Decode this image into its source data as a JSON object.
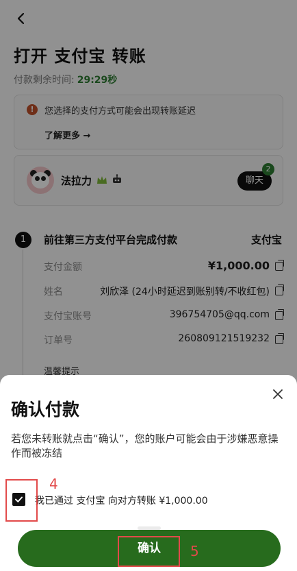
{
  "page": {
    "title": "打开 支付宝 转账",
    "timer_label": "付款剩余时间:",
    "timer_value": "29:29秒",
    "warning_text": "您选择的支付方式可能会出现转账延迟",
    "learn_more": "了解更多 →",
    "merchant": {
      "name": "法拉力",
      "chat_label": "聊天",
      "chat_badge": "2"
    },
    "step": {
      "number": "1",
      "title": "前往第三方支付平台完成付款",
      "method": "支付宝"
    },
    "details": [
      {
        "label": "支付金额",
        "value": "¥1,000.00"
      },
      {
        "label": "姓名",
        "value": "刘欣泽 (24小时延迟到账别转/不收红包)"
      },
      {
        "label": "支付宝账号",
        "value": "396754705@qq.com"
      },
      {
        "label": "订单号",
        "value": "260809121519232"
      }
    ],
    "tip_label": "温馨提示"
  },
  "sheet": {
    "title": "确认付款",
    "message": "若您未转账就点击“确认”，您的账户可能会由于涉嫌恶意操作而被冻结",
    "checkbox_label": "我已通过 支付宝 向对方转账 ¥1,000.00",
    "checkbox_checked": true,
    "confirm_label": "确认"
  },
  "annotations": {
    "mark4": "4",
    "mark5": "5"
  },
  "colors": {
    "primary_green": "#276b1d",
    "timer_green": "#2e7d32",
    "annotation_red": "#e24a4a"
  }
}
